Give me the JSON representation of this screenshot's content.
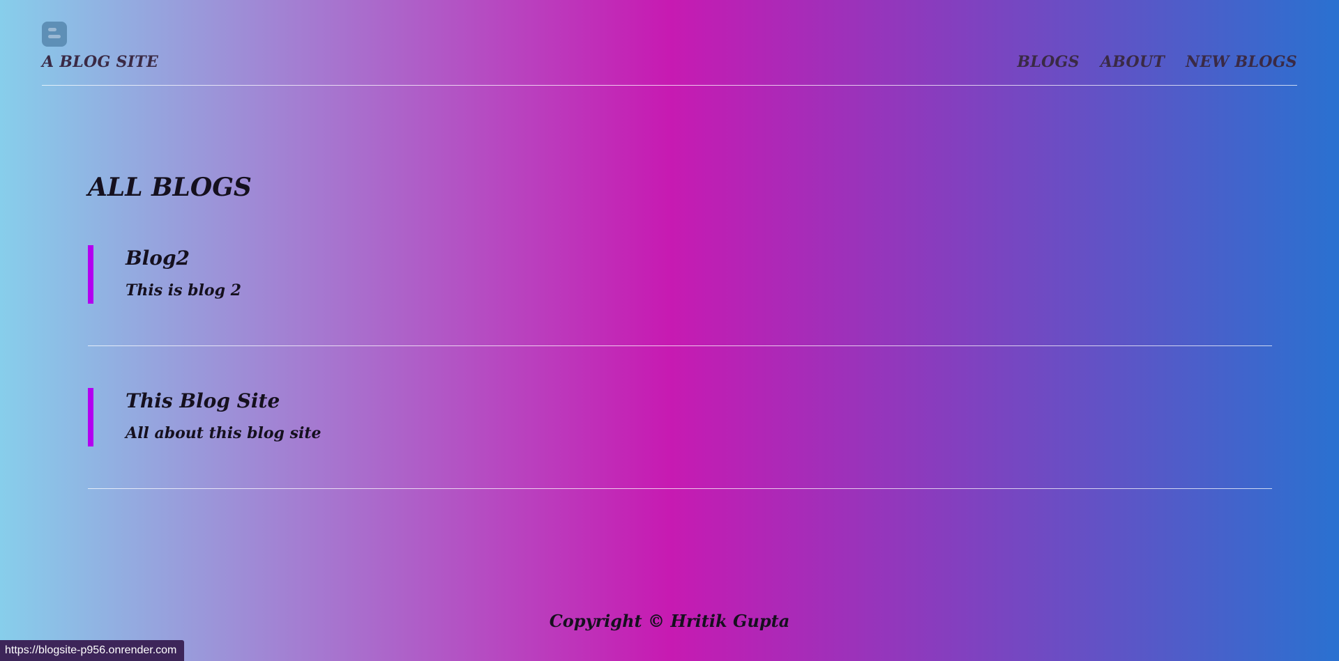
{
  "header": {
    "logo_icon": "blogger-icon",
    "site_title": "A BLOG SITE",
    "nav": {
      "blogs": "BLOGS",
      "about": "ABOUT",
      "new_blogs": "NEW BLOGS"
    }
  },
  "main": {
    "title": "ALL BLOGS",
    "blogs": [
      {
        "title": "Blog2",
        "description": "This is blog 2"
      },
      {
        "title": "This Blog Site",
        "description": "All about this blog site"
      }
    ]
  },
  "footer": {
    "copyright": "Copyright © Hritik Gupta"
  },
  "status_bar": {
    "url": "https://blogsite-p956.onrender.com"
  },
  "colors": {
    "gradient_start": "#87CEEB",
    "gradient_middle": "#C71AB2",
    "gradient_end": "#2A71D0",
    "accent_bar": "#B300F0",
    "divider": "#FFFFFF",
    "text": "#15101E"
  }
}
